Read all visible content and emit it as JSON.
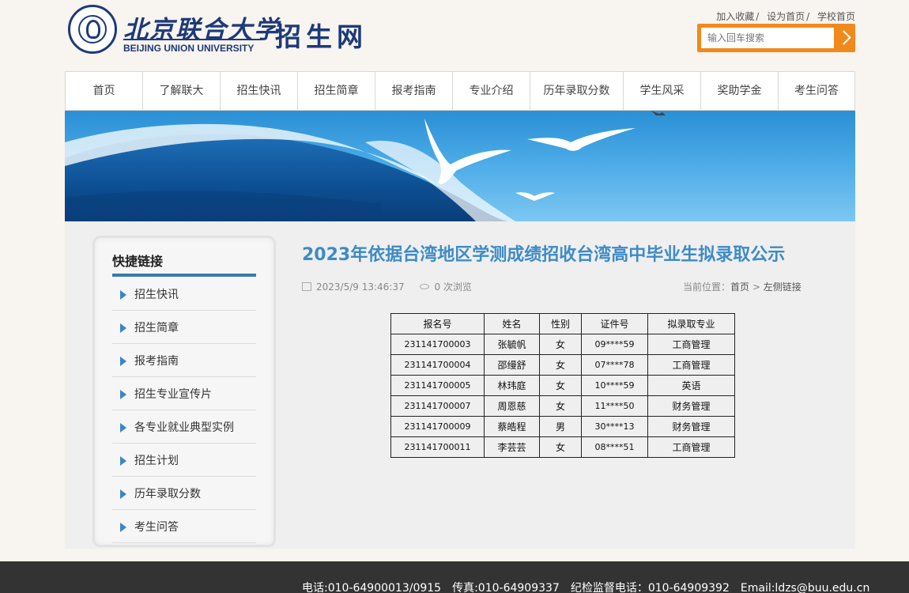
{
  "header": {
    "logo_cn": "北京联合大学",
    "logo_en": "BEIJING UNION UNIVERSITY",
    "site_name": "招生网",
    "top_links": [
      "加入收藏",
      "设为首页",
      "学校首页"
    ],
    "search_placeholder": "输入回车搜索"
  },
  "nav": [
    "首页",
    "了解联大",
    "招生快讯",
    "招生简章",
    "报考指南",
    "专业介绍",
    "历年录取分数",
    "学生风采",
    "奖助学金",
    "考生问答"
  ],
  "sidebar": {
    "title": "快捷链接",
    "items": [
      "招生快讯",
      "招生简章",
      "报考指南",
      "招生专业宣传片",
      "各专业就业典型实例",
      "招生计划",
      "历年录取分数",
      "考生问答"
    ]
  },
  "article": {
    "title": "2023年依据台湾地区学测成绩招收台湾高中毕业生拟录取公示",
    "date": "2023/5/9 13:46:37",
    "views": "0 次浏览",
    "crumb_prefix": "当前位置：",
    "crumb_home": "首页",
    "crumb_sep": " > ",
    "crumb_current": "左侧链接"
  },
  "table": {
    "headers": [
      "报名号",
      "姓名",
      "性别",
      "证件号",
      "拟录取专业"
    ],
    "rows": [
      [
        "231141700003",
        "张毓帆",
        "女",
        "09****59",
        "工商管理"
      ],
      [
        "231141700004",
        "邵缦舒",
        "女",
        "07****78",
        "工商管理"
      ],
      [
        "231141700005",
        "林玮庭",
        "女",
        "10****59",
        "英语"
      ],
      [
        "231141700007",
        "周恩慈",
        "女",
        "11****50",
        "财务管理"
      ],
      [
        "231141700009",
        "蔡皓程",
        "男",
        "30****13",
        "财务管理"
      ],
      [
        "231141700011",
        "李芸芸",
        "女",
        "08****51",
        "工商管理"
      ]
    ]
  },
  "footer": {
    "phone": "电话:010-64900013/0915",
    "fax": "传真:010-64909337",
    "supervision": "纪检监督电话：010-64909392",
    "email": "Email:ldzs@buu.edu.cn"
  }
}
